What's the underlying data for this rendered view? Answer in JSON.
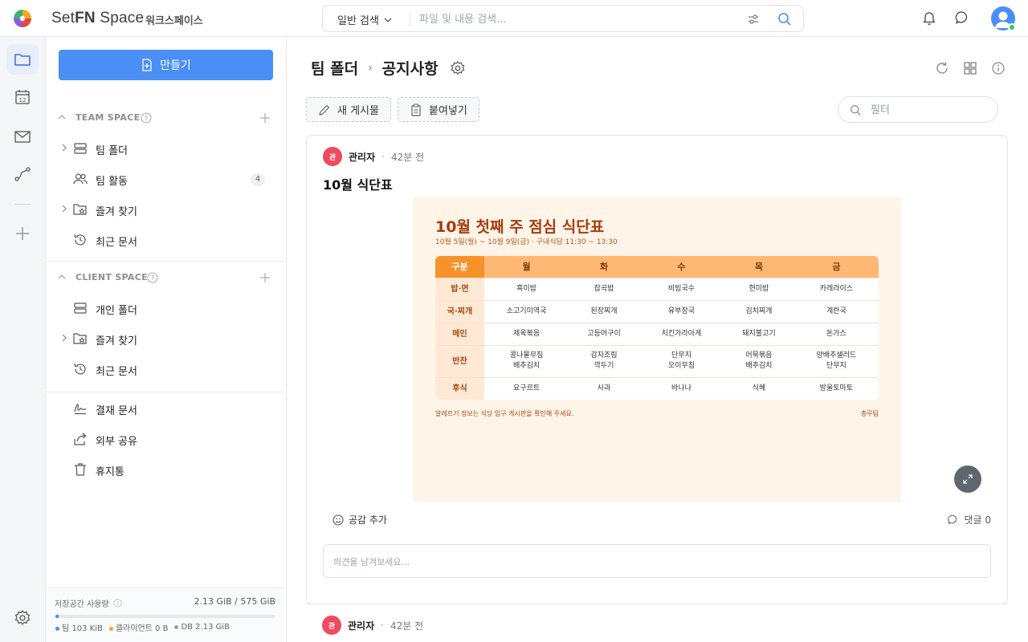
{
  "app": {
    "brand_part1": "Set",
    "brand_part2": "FN",
    "brand_part3": " Space",
    "workspace": "워크스페이스"
  },
  "search": {
    "type": "일반 검색",
    "placeholder": "파일 및 내용 검색..."
  },
  "sidebar": {
    "create_label": "만들기",
    "team_space": {
      "title": "TEAM SPACE",
      "items": [
        {
          "label": "팀 폴더"
        },
        {
          "label": "팀 활동",
          "badge": "4"
        },
        {
          "label": "즐겨 찾기"
        },
        {
          "label": "최근 문서"
        }
      ]
    },
    "client_space": {
      "title": "CLIENT SPACE",
      "items": [
        {
          "label": "개인 폴더"
        },
        {
          "label": "즐겨 찾기"
        },
        {
          "label": "최근 문서"
        }
      ]
    },
    "extra_items": [
      {
        "label": "결재 문서"
      },
      {
        "label": "외부 공유"
      },
      {
        "label": "휴지통"
      }
    ],
    "storage": {
      "title": "저장공간 사용량",
      "value": "2.13 GiB / 575 GiB",
      "usage_fraction": 0.004,
      "legend_team": "팀 103 KiB",
      "legend_client": "클라이언트 0 B",
      "legend_db": "DB 2.13 GiB"
    }
  },
  "main": {
    "breadcrumb": [
      "팀 폴더",
      "공지사항"
    ],
    "new_post_label": "새 게시물",
    "paste_label": "붙여넣기",
    "filter_placeholder": "필터",
    "post": {
      "author_initial": "관",
      "author": "관리자",
      "time": "42분 전",
      "title": "10월 식단표",
      "react_label": "공감 추가",
      "comment_label": "댓글 0",
      "comment_placeholder": "의견을 남겨보세요..."
    },
    "post2": {
      "author_initial": "관",
      "author": "관리자",
      "time": "42분 전"
    }
  },
  "meal": {
    "title": "10월 첫째 주 점심 식단표",
    "subtitle": "10월 5일(월) ~ 10월 9일(금) · 구내식당 11:30 ~ 13:30",
    "header": [
      "구분",
      "월",
      "화",
      "수",
      "목",
      "금"
    ],
    "rows": [
      {
        "label": "밥·면",
        "cells": [
          "흑미밥",
          "잡곡밥",
          "비빔국수",
          "현미밥",
          "카레라이스"
        ]
      },
      {
        "label": "국·찌개",
        "cells": [
          "소고기미역국",
          "된장찌개",
          "유부장국",
          "김치찌개",
          "계란국"
        ]
      },
      {
        "label": "메인",
        "cells": [
          "제육볶음",
          "고등어구이",
          "치킨가라아게",
          "돼지불고기",
          "돈가스"
        ]
      },
      {
        "label": "반찬",
        "cells": [
          "콩나물무침\n배추김치",
          "감자조림\n깍두기",
          "단무지\n오이무침",
          "어묵볶음\n배추김치",
          "양배추샐러드\n단무지"
        ]
      },
      {
        "label": "후식",
        "cells": [
          "요구르트",
          "사과",
          "바나나",
          "식혜",
          "방울토마토"
        ]
      }
    ],
    "note": "알레르기 정보는 식당 입구 게시판을 확인해 주세요.",
    "sign": "총무팀"
  },
  "colors": {
    "accent": "#4a8ff5",
    "avatar_red": "#f04a5e",
    "online": "#2ecc71"
  }
}
